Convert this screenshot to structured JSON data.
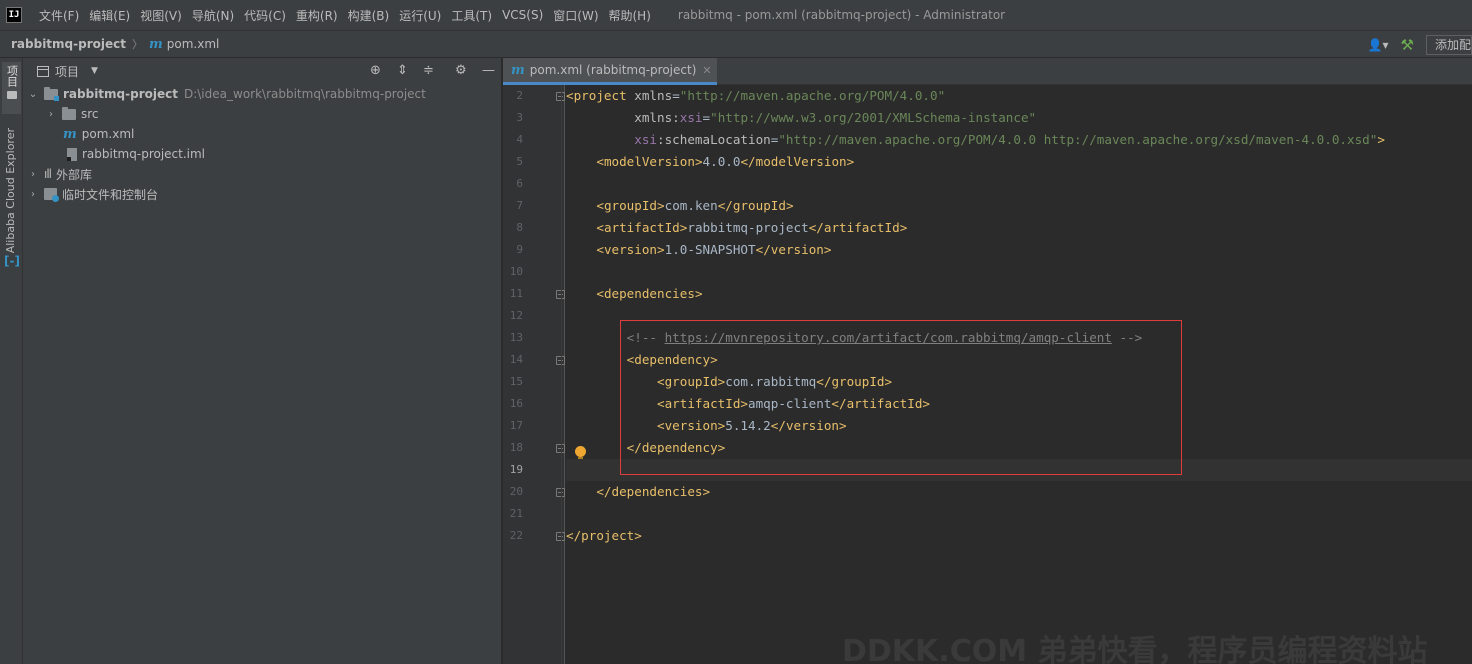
{
  "menubar": {
    "logo": "IJ",
    "items": [
      "文件(F)",
      "编辑(E)",
      "视图(V)",
      "导航(N)",
      "代码(C)",
      "重构(R)",
      "构建(B)",
      "运行(U)",
      "工具(T)",
      "VCS(S)",
      "窗口(W)",
      "帮助(H)"
    ],
    "window_title": "rabbitmq - pom.xml (rabbitmq-project) - Administrator"
  },
  "navbar": {
    "project": "rabbitmq-project",
    "file_icon": "m",
    "file": "pom.xml",
    "add_config_label": "添加配置..."
  },
  "left_strip": {
    "project_label": "项目",
    "cloud_label": "Alibaba Cloud Explorer"
  },
  "project_panel": {
    "title": "项目",
    "tree": [
      {
        "label": "rabbitmq-project",
        "path": "D:\\idea_work\\rabbitmq\\rabbitmq-project"
      },
      {
        "label": "src"
      },
      {
        "label": "pom.xml"
      },
      {
        "label": "rabbitmq-project.iml"
      },
      {
        "label": "外部库"
      },
      {
        "label": "临时文件和控制台"
      }
    ]
  },
  "editor": {
    "tab_label": "pom.xml (rabbitmq-project)",
    "current_line": 19,
    "line_numbers": [
      "2",
      "3",
      "4",
      "5",
      "6",
      "7",
      "8",
      "9",
      "10",
      "11",
      "12",
      "13",
      "14",
      "15",
      "16",
      "17",
      "18",
      "19",
      "20",
      "21",
      "22"
    ],
    "code": {
      "l2_project": "project",
      "l2_xmlns_attr": "xmlns",
      "l2_xmlns_val": "\"http://maven.apache.org/POM/4.0.0\"",
      "l3_xmlns": "xmlns",
      "l3_xsi": "xsi",
      "l3_val": "\"http://www.w3.org/2001/XMLSchema-instance\"",
      "l4_xsi": "xsi",
      "l4_attr": "schemaLocation",
      "l4_val": "\"http://maven.apache.org/POM/4.0.0 http://maven.apache.org/xsd/maven-4.0.0.xsd\"",
      "model_tag": "modelVersion",
      "model_val": "4.0.0",
      "group_tag": "groupId",
      "group_val": "com.ken",
      "artifact_tag": "artifactId",
      "artifact_val": "rabbitmq-project",
      "version_tag": "version",
      "version_val": "1.0-SNAPSHOT",
      "deps_tag": "dependencies",
      "comment_open": "<!-- ",
      "comment_url": "https://mvnrepository.com/artifact/com.rabbitmq/amqp-client",
      "comment_close": " -->",
      "dep_tag": "dependency",
      "dep_group_val": "com.rabbitmq",
      "dep_artifact_val": "amqp-client",
      "dep_version_val": "5.14.2"
    }
  },
  "watermark": "DDKK.COM 弟弟快看，程序员编程资料站"
}
